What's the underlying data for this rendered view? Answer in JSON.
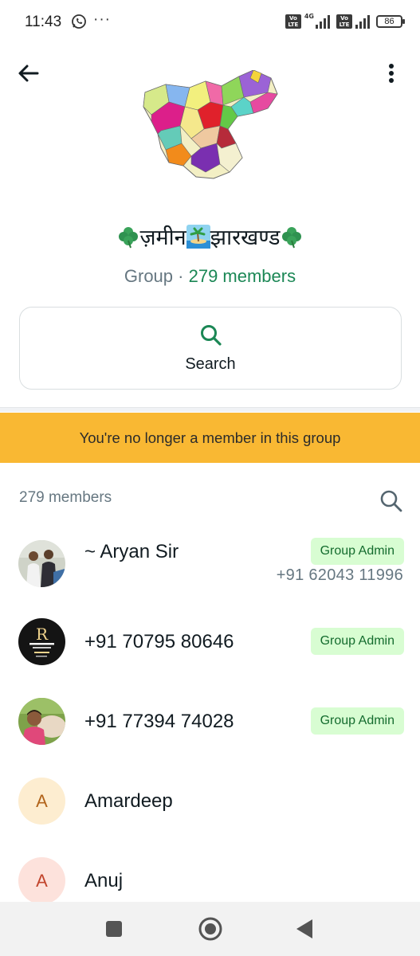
{
  "status_bar": {
    "time": "11:43",
    "more": "···",
    "volte_1": "Vo LTE",
    "network_1": "4G",
    "volte_2": "Vo LTE",
    "battery": "86"
  },
  "header": {
    "back_icon": "arrow-left-icon",
    "menu_icon": "more-vert-icon"
  },
  "group": {
    "photo_icon": "jharkhand-map-image",
    "name_left_emoji": "shamrock",
    "name_text_1": "ज़मीन",
    "name_mid_emoji": "desert-island",
    "name_text_2": "झारखण्ड",
    "name_right_emoji": "shamrock",
    "type_label": "Group",
    "separator": " · ",
    "member_count": "279 members"
  },
  "search": {
    "label": "Search",
    "icon": "search-icon"
  },
  "banner": {
    "text": "You're no longer a member in this group",
    "color": "#f9b833"
  },
  "members": {
    "header": "279 members",
    "items": [
      {
        "name": "~ Aryan Sir",
        "badge": "Group Admin",
        "phone": "+91 62043 11996",
        "avatar": "photo-two-men"
      },
      {
        "name": "+91 70795 80646",
        "badge": "Group Admin",
        "avatar": "radiann-tutorial-logo"
      },
      {
        "name": "+91 77394 74028",
        "badge": "Group Admin",
        "avatar": "photo-man-selfie"
      },
      {
        "name": "Amardeep",
        "letter": "A",
        "avatar_bg": "#fdedd0",
        "avatar_fg": "#b2641b"
      },
      {
        "name": "Anuj",
        "letter": "A",
        "avatar_bg": "#fde2dc",
        "avatar_fg": "#c2452d"
      }
    ]
  },
  "colors": {
    "accent_green": "#1b8755",
    "badge_bg": "#d8fdd2",
    "badge_fg": "#146c2e",
    "secondary_text": "#667781"
  },
  "nav": {
    "recents_icon": "square-icon",
    "home_icon": "circle-home-icon",
    "back_icon": "triangle-back-icon"
  }
}
